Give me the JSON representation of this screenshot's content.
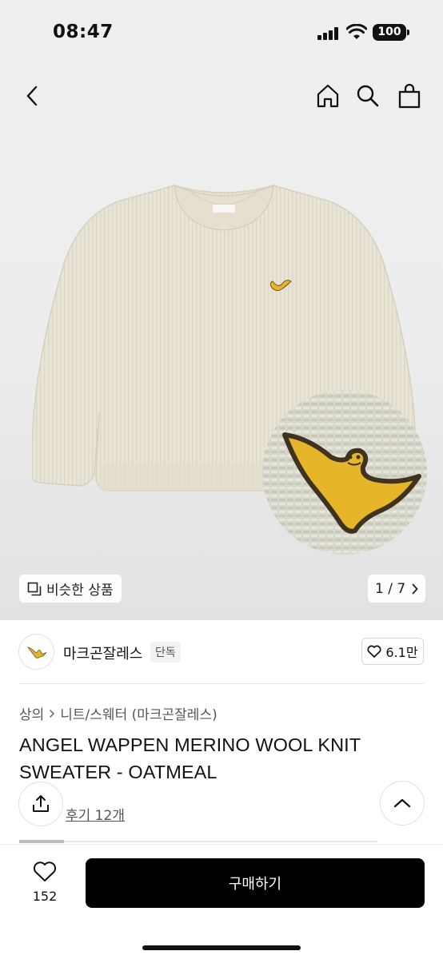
{
  "status_bar": {
    "time": "08:47",
    "battery": "100"
  },
  "gallery": {
    "similar_label": "비슷한 상품",
    "pager": "1 / 7"
  },
  "brand": {
    "name": "마크곤잘레스",
    "tag": "단독",
    "likes": "6.1만"
  },
  "breadcrumb": {
    "category": "상의",
    "subcategory": "니트/스웨터 (마크곤잘레스)"
  },
  "product": {
    "title": "ANGEL WAPPEN MERINO WOOL KNIT SWEATER - OATMEAL",
    "review_text": "후기 12개"
  },
  "bottom": {
    "wish_count": "152",
    "buy_label": "구매하기"
  },
  "colors": {
    "sweater": "#e9e5d6",
    "angel_yellow": "#e6b52a",
    "buy_button": "#000000"
  }
}
